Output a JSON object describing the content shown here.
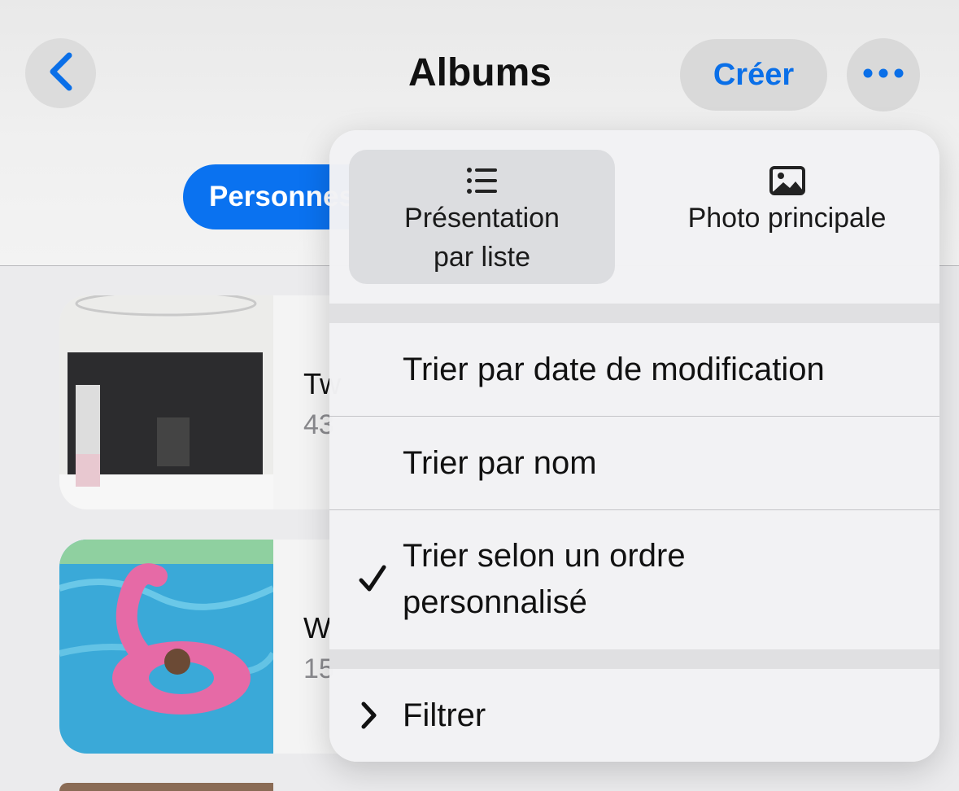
{
  "header": {
    "title": "Albums",
    "create_label": "Créer",
    "back_icon": "chevron-left-icon",
    "more_icon": "ellipsis-icon"
  },
  "filter_chip": {
    "label": "Personnes"
  },
  "albums": [
    {
      "name": "Tw",
      "count": "43"
    },
    {
      "name": "W",
      "count": "15"
    }
  ],
  "menu": {
    "view_options": [
      {
        "icon": "list-icon",
        "label_line1": "Présentation",
        "label_line2": "par liste",
        "selected": true
      },
      {
        "icon": "photo-icon",
        "label": "Photo principale",
        "selected": false
      }
    ],
    "sort_items": [
      {
        "label": "Trier par date de modification",
        "checked": false
      },
      {
        "label": "Trier par nom",
        "checked": false
      },
      {
        "label_line1": "Trier selon un ordre",
        "label_line2": "personnalisé",
        "checked": true
      }
    ],
    "filter_item": {
      "label": "Filtrer",
      "icon": "chevron-right-icon"
    }
  },
  "colors": {
    "accent": "#0a72f0",
    "link": "#0a6fe8"
  }
}
